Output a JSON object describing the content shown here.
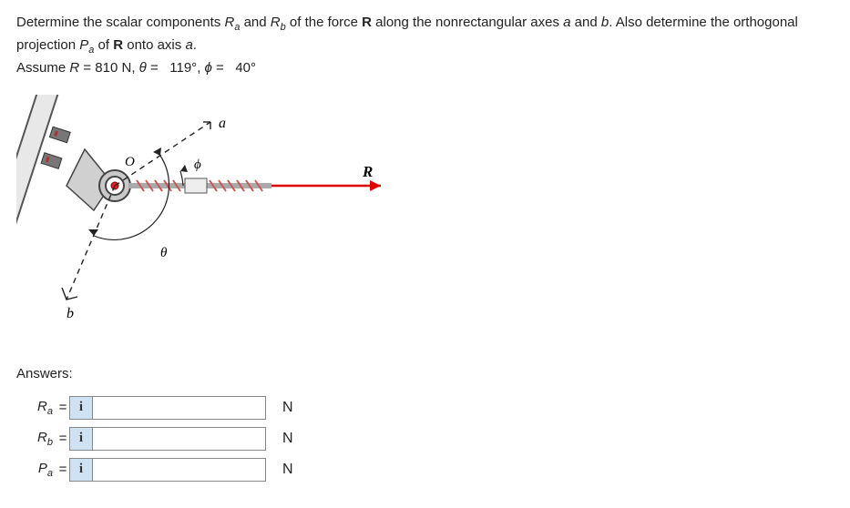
{
  "prompt": {
    "line1_a": "Determine the scalar components ",
    "Ra": "R",
    "Ra_sub": "a",
    "line1_b": " and ",
    "Rb": "R",
    "Rb_sub": "b",
    "line1_c": " of the force ",
    "R_vec": "R",
    "line1_d": " along the nonrectangular axes ",
    "a_var": "a",
    "line1_e": " and ",
    "b_var": "b",
    "line1_f": ". Also determine the orthogonal projection ",
    "Pa": "P",
    "Pa_sub": "a",
    "line1_g": " of ",
    "R_vec2": "R",
    "line1_h": " onto axis ",
    "a_var2": "a",
    "line1_i": ".",
    "line2_a": "Assume ",
    "R_sym": "R",
    "line2_b": " = 810 N, ",
    "theta": "θ",
    "line2_c": " = ",
    "theta_val": "119°",
    "line2_d": ", ",
    "phi": "ϕ",
    "line2_e": " = ",
    "phi_val": "40°"
  },
  "figure": {
    "label_a": "a",
    "label_b": "b",
    "label_O": "O",
    "label_phi": "ϕ",
    "label_theta": "θ",
    "label_R": "R"
  },
  "answers": {
    "heading": "Answers:",
    "rows": [
      {
        "base": "R",
        "sub": "a",
        "unit": "N",
        "value": ""
      },
      {
        "base": "R",
        "sub": "b",
        "unit": "N",
        "value": ""
      },
      {
        "base": "P",
        "sub": "a",
        "unit": "N",
        "value": ""
      }
    ],
    "icon_char": "i"
  }
}
